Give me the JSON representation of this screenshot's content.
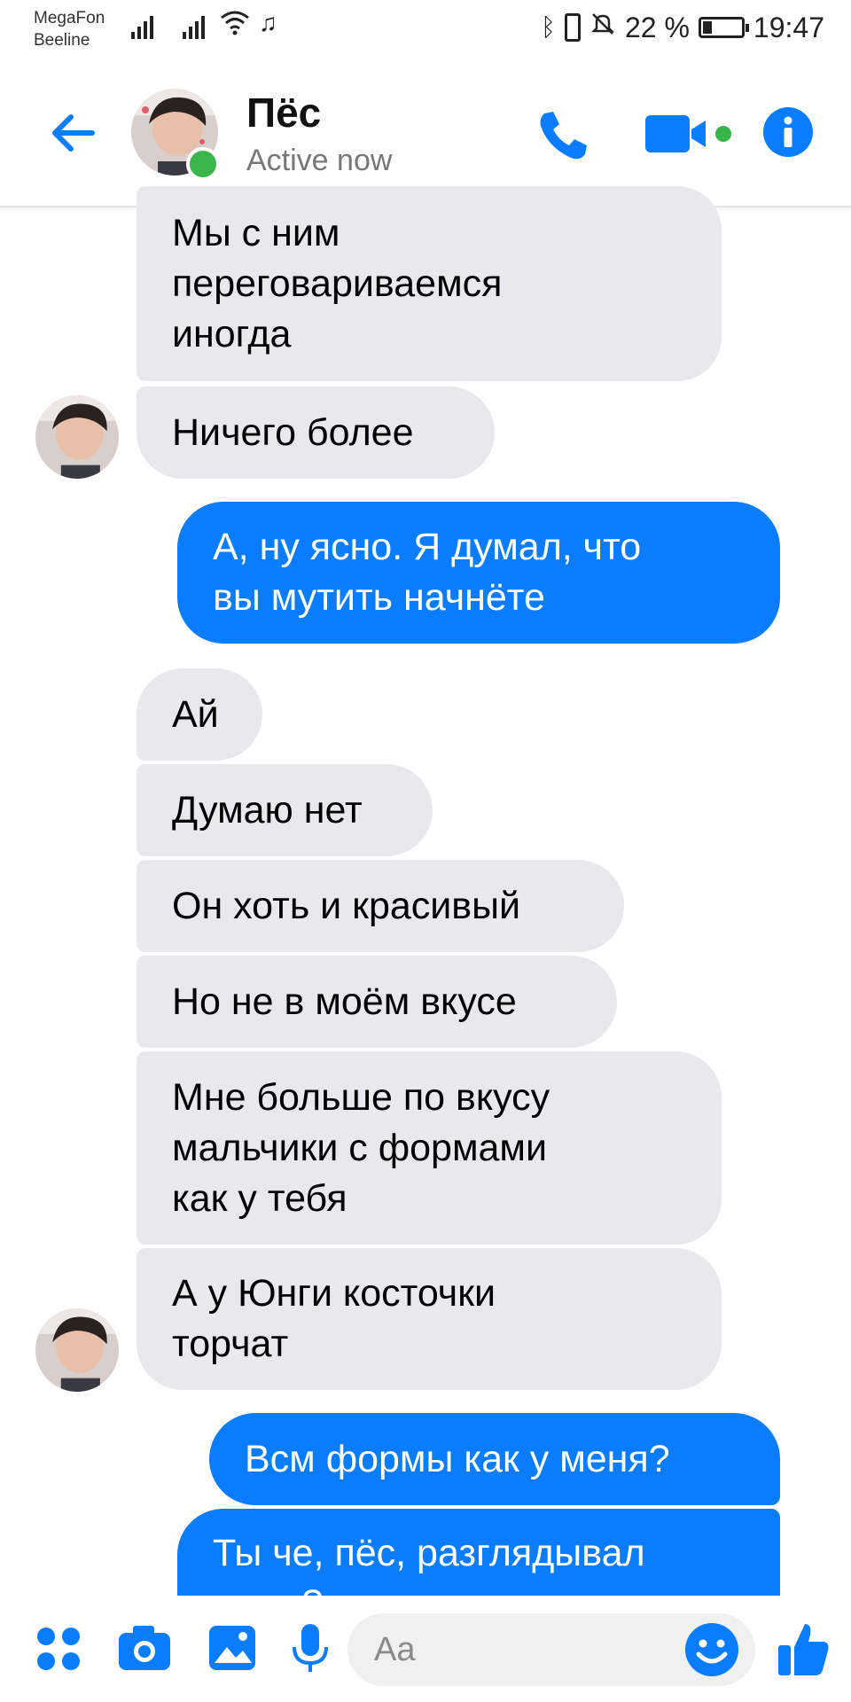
{
  "status_bar": {
    "carrier_1": "MegaFon",
    "carrier_2": "Beeline",
    "battery": "22 %",
    "time": "19:47"
  },
  "header": {
    "contact_name": "Пёс",
    "status": "Active now",
    "accent_color": "#0a7cff",
    "online_color": "#3ab54a"
  },
  "messages": [
    {
      "dir": "in",
      "text": "Мы с ним\nпереговариваемся\nиногда"
    },
    {
      "dir": "in",
      "text": "Ничего более"
    },
    {
      "dir": "out",
      "text": "А, ну ясно. Я думал, что\nвы мутить начнёте"
    },
    {
      "dir": "in",
      "text": "Ай"
    },
    {
      "dir": "in",
      "text": "Думаю нет"
    },
    {
      "dir": "in",
      "text": "Он хоть и красивый"
    },
    {
      "dir": "in",
      "text": "Но не в моём вкусе"
    },
    {
      "dir": "in",
      "text": "Мне больше по вкусу\nмальчики с формами\nкак у тебя"
    },
    {
      "dir": "in",
      "text": "А у Юнги косточки\nторчат"
    },
    {
      "dir": "out",
      "text": "Всм формы как у меня?"
    },
    {
      "dir": "out",
      "text": "Ты че, пёс, разглядывал\nменя?"
    }
  ],
  "composer": {
    "placeholder": "Aa",
    "icons": [
      "menu-dots-icon",
      "camera-icon",
      "gallery-icon",
      "microphone-icon",
      "emoji-icon",
      "like-icon"
    ]
  }
}
